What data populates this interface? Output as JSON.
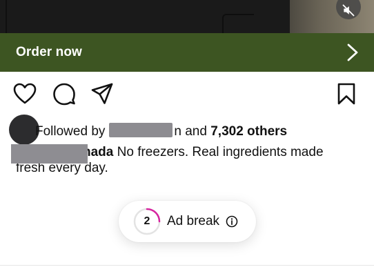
{
  "media": {
    "mute_icon": "speaker-muted-icon"
  },
  "cta": {
    "label": "Order now",
    "icon": "chevron-right-icon",
    "background": "#3d5522"
  },
  "actions": {
    "like_icon": "heart-icon",
    "comment_icon": "comment-bubble-icon",
    "share_icon": "paper-plane-icon",
    "save_icon": "bookmark-icon"
  },
  "social": {
    "followed_prefix": "Followed by",
    "followed_suffix_plain": "n and ",
    "followed_suffix_bold": "7,302 others"
  },
  "caption": {
    "username_visible": "nada",
    "text_line1": " No freezers. Real ingredients made",
    "text_line2": "fresh every day."
  },
  "ad_break": {
    "countdown": "2",
    "label": "Ad break",
    "progress_fraction": 0.25,
    "progress_color": "#d6249f",
    "info_icon": "info-circle-icon"
  }
}
